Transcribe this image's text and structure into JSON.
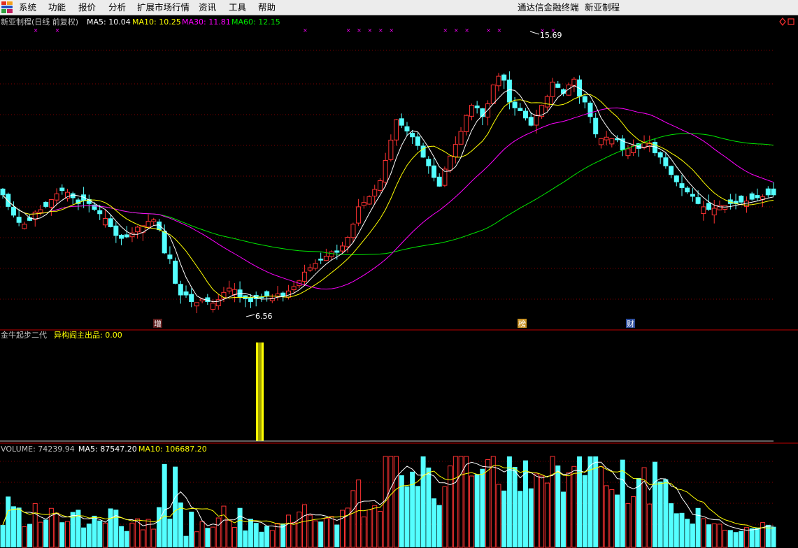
{
  "menu": {
    "items": [
      "系统",
      "功能",
      "报价",
      "分析",
      "扩展市场行情",
      "资讯",
      "工具",
      "帮助"
    ],
    "app_title": "通达信金融终端",
    "stock_name": "新亚制程"
  },
  "main_header": {
    "title": "新亚制程(日线 前复权)",
    "ma5": "MA5: 10.04",
    "ma10": "MA10: 10.25",
    "ma30": "MA30: 11.81",
    "ma60": "MA60: 12.15"
  },
  "annotations": {
    "high_label": "15.69",
    "low_label": "6.56",
    "events": [
      "增",
      "榜",
      "财"
    ]
  },
  "indicator_header": {
    "name": "金牛起步二代",
    "series": "异构阎主出品: 0.00"
  },
  "volume_header": {
    "volume": "VOLUME: 74239.94",
    "ma5": "MA5: 87547.20",
    "ma10": "MA10: 106687.20"
  },
  "colors": {
    "up": "#ff3232",
    "down": "#54ffff",
    "ma5": "#ffffff",
    "ma10": "#ffff00",
    "ma30": "#ff00ff",
    "ma60": "#00e600",
    "grid": "#800000",
    "marker": "#ff00ff",
    "indicator": "#ffff00"
  },
  "chart_data": {
    "type": "candlestick",
    "price_range": [
      6.56,
      15.69
    ],
    "close_series": [
      10.6,
      10.2,
      9.9,
      9.65,
      9.6,
      9.72,
      10.02,
      10.1,
      10.2,
      10.45,
      10.65,
      10.75,
      10.7,
      10.5,
      10.3,
      10.4,
      10.3,
      10.1,
      9.95,
      9.8,
      9.5,
      9.2,
      9.1,
      9.15,
      9.3,
      9.5,
      9.55,
      9.7,
      9.75,
      9.4,
      8.6,
      8.4,
      7.55,
      7.15,
      7.15,
      6.92,
      6.9,
      7.02,
      6.92,
      6.88,
      7.0,
      7.25,
      7.4,
      7.35,
      7.08,
      7.02,
      6.92,
      7.02,
      7.05,
      7.12,
      7.05,
      7.2,
      7.12,
      7.3,
      7.45,
      7.65,
      7.95,
      8.1,
      8.25,
      8.35,
      8.5,
      8.65,
      8.62,
      8.85,
      9.15,
      9.6,
      10.2,
      10.35,
      10.55,
      10.8,
      11.1,
      11.8,
      12.5,
      13.2,
      13.0,
      12.8,
      12.6,
      12.3,
      11.9,
      11.6,
      11.2,
      10.9,
      11.5,
      11.95,
      12.35,
      12.8,
      13.35,
      13.7,
      13.6,
      13.3,
      13.75,
      14.4,
      14.7,
      14.55,
      13.8,
      13.6,
      13.5,
      13.25,
      13.0,
      13.35,
      13.7,
      14.0,
      14.5,
      14.3,
      14.1,
      14.4,
      14.6,
      14.0,
      13.8,
      13.3,
      12.7,
      12.55,
      12.6,
      12.55,
      12.5,
      12.15,
      12.2,
      12.3,
      12.2,
      12.4,
      12.4,
      12.05,
      11.9,
      11.6,
      11.3,
      11.05,
      10.85,
      10.7,
      10.55,
      10.3,
      10.2,
      10.1,
      10.15,
      10.25,
      10.25,
      10.3,
      10.3,
      10.35,
      10.4,
      10.45,
      10.5,
      10.55,
      10.6,
      10.6
    ],
    "moving_averages": [
      "MA5",
      "MA10",
      "MA30",
      "MA60"
    ],
    "indicator": {
      "name": "金牛起步二代",
      "value": 0.0
    },
    "volume": {
      "last": 74239.94,
      "ma5": 87547.2,
      "ma10": 106687.2
    }
  }
}
